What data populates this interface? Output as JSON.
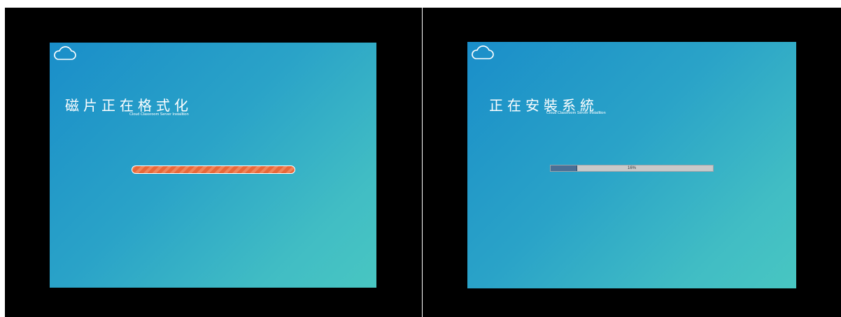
{
  "screens": [
    {
      "title": "磁片正在格式化",
      "subtitle": "Cloud Classroom Server Installtion",
      "indicator": "striped-progress-bar"
    },
    {
      "title": "正在安裝系統",
      "subtitle": "Cloud Classroom Server Installtion",
      "progress": {
        "value": 16,
        "label": "16%"
      }
    }
  ],
  "colors": {
    "gradient_start": "#1a8ec9",
    "gradient_end": "#48c6c2",
    "stripe_orange": "#e8683a",
    "progress_fill": "#4a6f95",
    "progress_track": "#c9c9c9"
  },
  "icons": [
    "cloud-icon"
  ]
}
